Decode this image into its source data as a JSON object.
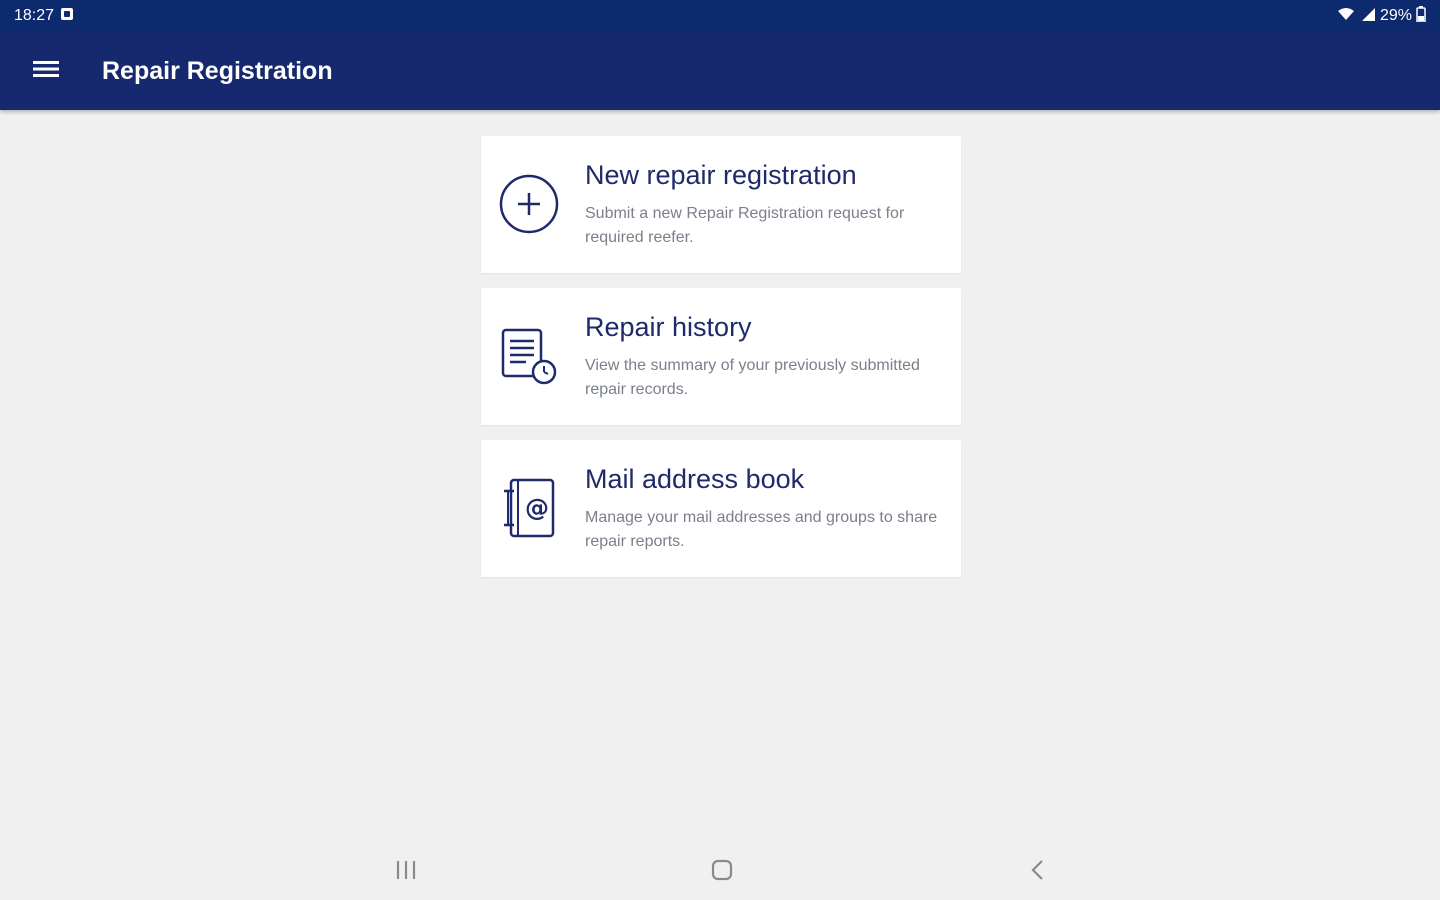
{
  "status_bar": {
    "time": "18:27",
    "battery": "29%",
    "icons": [
      "notification-icon",
      "wifi-icon",
      "signal-icon",
      "battery-icon"
    ]
  },
  "app_bar": {
    "title": "Repair Registration",
    "menu_icon": "hamburger-menu-icon"
  },
  "cards": [
    {
      "title": "New repair registration",
      "description": "Submit a new Repair Registration request for required reefer.",
      "icon": "add-circle-icon"
    },
    {
      "title": "Repair history",
      "description": "View the summary of your previously submitted repair records.",
      "icon": "history-document-icon"
    },
    {
      "title": "Mail address book",
      "description": "Manage your mail addresses and groups to share repair reports.",
      "icon": "address-book-icon"
    }
  ],
  "nav_bar": {
    "icons": [
      "recent-apps-icon",
      "home-icon",
      "back-icon"
    ]
  },
  "colors": {
    "status_bar": "#0d2a6e",
    "app_bar": "#16296e",
    "accent": "#1f2a6b",
    "background": "#f0f0f0",
    "card": "#ffffff",
    "description_text": "#7a7f8c"
  }
}
